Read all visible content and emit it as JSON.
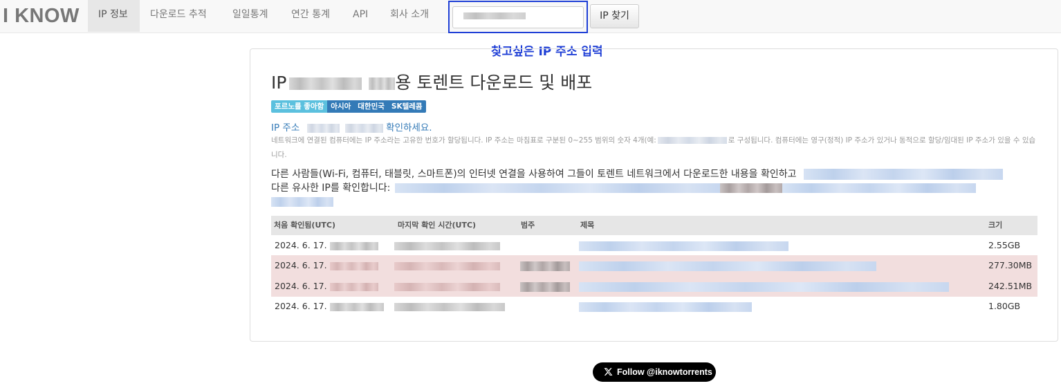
{
  "navbar": {
    "brand": "I KNOW",
    "items": [
      {
        "label": "IP 정보",
        "active": true
      },
      {
        "label": "다운로드 추적",
        "active": false
      },
      {
        "label": "일일통계",
        "active": false
      },
      {
        "label": "연간 통계",
        "active": false
      },
      {
        "label": "API",
        "active": false
      },
      {
        "label": "회사 소개",
        "active": false
      }
    ],
    "search_button": "IP 찾기"
  },
  "annotation": "찾고싶은 IP 주소 입력",
  "main": {
    "title_prefix": "IP",
    "title_suffix": "용 토렌트 다운로드 및 배포",
    "labels": [
      {
        "text": "포르노를 좋아함",
        "style": "info"
      },
      {
        "text": "아시아",
        "style": "primary"
      },
      {
        "text": "대한민국",
        "style": "primary"
      },
      {
        "text": "SK텔레콤",
        "style": "primary"
      }
    ],
    "ip_line_prefix": "IP 주소",
    "ip_line_suffix": "확인하세요.",
    "desc_part1": "네트워크에 연결된 컴퓨터에는 IP 주소라는 고유한 번호가 할당됩니다. IP 주소는 마침표로 구분된 0~255 범위의 숫자 4개(예:",
    "desc_part2": "로 구성됩니다. 컴퓨터에는 영구(정적) IP 주소가 있거나 동적으로 할당/임대된 IP 주소가 있을 수 있습니다.",
    "lead_part1": "다른 사람들(Wi-Fi, 컴퓨터, 태블릿, 스마트폰)의 인터넷 연결을 사용하여 그들이 토렌트 네트워크에서 다운로드한 내용을 확인하고",
    "lead_part2": "다른 유사한 IP를 확인합니다:"
  },
  "table": {
    "headers": [
      "처음 확인됨(UTC)",
      "마지막 확인 시간(UTC)",
      "범주",
      "제목",
      "크기"
    ],
    "rows": [
      {
        "first_seen": "2024. 6. 17. ",
        "size": "2.55GB",
        "highlight": false
      },
      {
        "first_seen": "2024. 6. 17. ",
        "size": "277.30MB",
        "highlight": true
      },
      {
        "first_seen": "2024. 6. 17. ",
        "size": "242.51MB",
        "highlight": true
      },
      {
        "first_seen": "2024. 6. 17. ",
        "size": "1.80GB",
        "highlight": false
      }
    ]
  },
  "follow_button": "Follow @iknowtorrents",
  "colors": {
    "annotation": "#1f3fd6",
    "label_info": "#5bc0de",
    "label_primary": "#337ab7",
    "row_danger": "#f2dede",
    "link": "#337ab7"
  }
}
